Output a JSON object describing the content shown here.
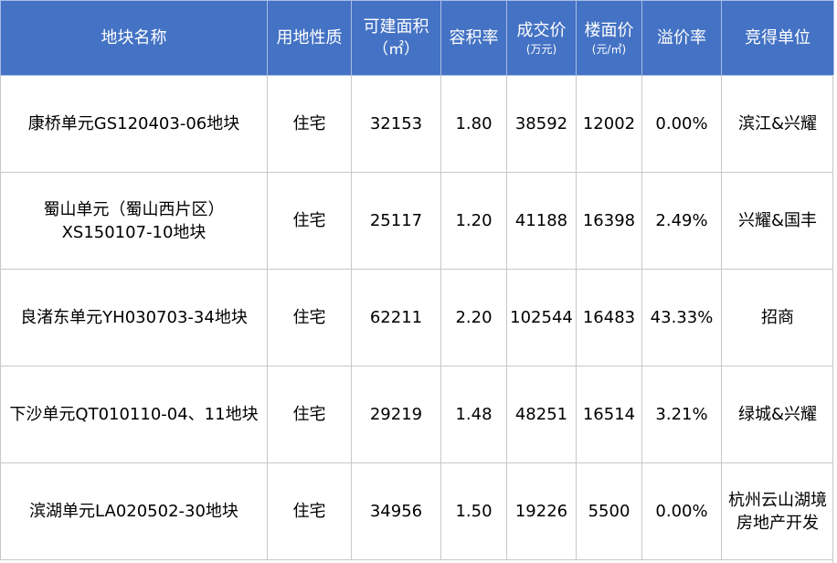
{
  "headers": {
    "name": "地块名称",
    "use": "用地性质",
    "area_main": "可建面积",
    "area_unit": "（㎡）",
    "far": "容积率",
    "price_main": "成交价",
    "price_unit": "(万元)",
    "floor_main": "楼面价",
    "floor_unit": "(元/㎡)",
    "premium": "溢价率",
    "winner": "竞得单位"
  },
  "rows": [
    {
      "name_line1": "康桥单元GS120403-06地块",
      "name_line2": "",
      "use": "住宅",
      "area": "32153",
      "far": "1.80",
      "price": "38592",
      "floor_price": "12002",
      "premium": "0.00%",
      "winner_line1": "滨江&兴耀",
      "winner_line2": ""
    },
    {
      "name_line1": "蜀山单元（蜀山西片区）",
      "name_line2": "XS150107-10地块",
      "use": "住宅",
      "area": "25117",
      "far": "1.20",
      "price": "41188",
      "floor_price": "16398",
      "premium": "2.49%",
      "winner_line1": "兴耀&国丰",
      "winner_line2": ""
    },
    {
      "name_line1": "良渚东单元YH030703-34地块",
      "name_line2": "",
      "use": "住宅",
      "area": "62211",
      "far": "2.20",
      "price": "102544",
      "floor_price": "16483",
      "premium": "43.33%",
      "winner_line1": "招商",
      "winner_line2": ""
    },
    {
      "name_line1": "下沙单元QT010110-04、11地块",
      "name_line2": "",
      "use": "住宅",
      "area": "29219",
      "far": "1.48",
      "price": "48251",
      "floor_price": "16514",
      "premium": "3.21%",
      "winner_line1": "绿城&兴耀",
      "winner_line2": ""
    },
    {
      "name_line1": "滨湖单元LA020502-30地块",
      "name_line2": "",
      "use": "住宅",
      "area": "34956",
      "far": "1.50",
      "price": "19226",
      "floor_price": "5500",
      "premium": "0.00%",
      "winner_line1": "杭州云山湖境",
      "winner_line2": "房地产开发"
    }
  ],
  "colors": {
    "header_bg": "#4472c4",
    "header_text": "#ffffff",
    "grid": "#c8c8c8"
  }
}
